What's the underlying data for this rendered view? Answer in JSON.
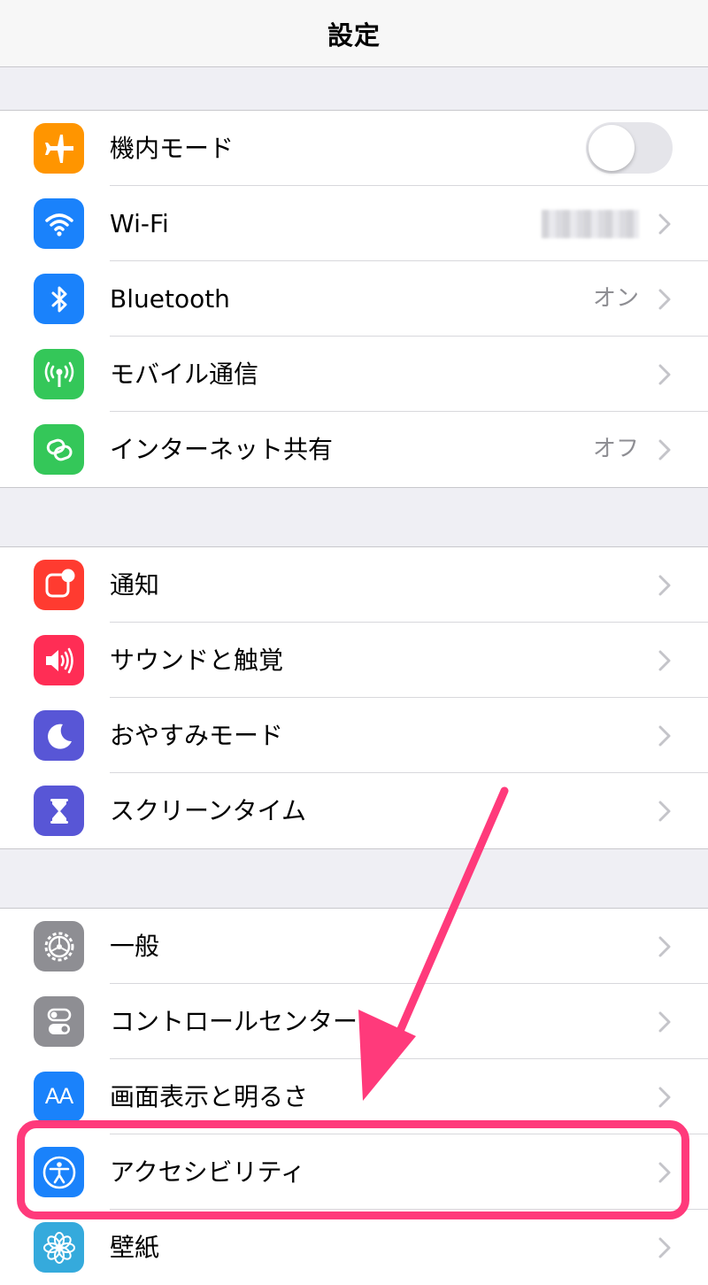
{
  "navbar": {
    "title": "設定"
  },
  "groups": [
    {
      "rows": [
        {
          "icon": "airplane-icon",
          "color": "#ff9500",
          "label": "機内モード",
          "accessory": "toggle",
          "toggle_on": false
        },
        {
          "icon": "wifi-icon",
          "color": "#1a82fb",
          "label": "Wi-Fi",
          "detail": "",
          "accessory": "chevron"
        },
        {
          "icon": "bluetooth-icon",
          "color": "#1a82fb",
          "label": "Bluetooth",
          "detail": "オン",
          "accessory": "chevron"
        },
        {
          "icon": "cellular-icon",
          "color": "#34c759",
          "label": "モバイル通信",
          "accessory": "chevron"
        },
        {
          "icon": "hotspot-icon",
          "color": "#34c759",
          "label": "インターネット共有",
          "detail": "オフ",
          "accessory": "chevron"
        }
      ]
    },
    {
      "rows": [
        {
          "icon": "notifications-icon",
          "color": "#ff3b30",
          "label": "通知",
          "accessory": "chevron"
        },
        {
          "icon": "sound-icon",
          "color": "#ff2d55",
          "label": "サウンドと触覚",
          "accessory": "chevron"
        },
        {
          "icon": "moon-icon",
          "color": "#5856d6",
          "label": "おやすみモード",
          "accessory": "chevron"
        },
        {
          "icon": "hourglass-icon",
          "color": "#5856d6",
          "label": "スクリーンタイム",
          "accessory": "chevron"
        }
      ]
    },
    {
      "rows": [
        {
          "icon": "gear-icon",
          "color": "#8e8e93",
          "label": "一般",
          "accessory": "chevron"
        },
        {
          "icon": "toggles-icon",
          "color": "#8e8e93",
          "label": "コントロールセンター",
          "accessory": "chevron"
        },
        {
          "icon": "text-size-icon",
          "color": "#1a82fb",
          "label": "画面表示と明るさ",
          "icon_text": "AA",
          "accessory": "chevron"
        },
        {
          "icon": "accessibility-icon",
          "color": "#1a82fb",
          "label": "アクセシビリティ",
          "accessory": "chevron"
        },
        {
          "icon": "flower-icon",
          "color": "#35aadc",
          "label": "壁紙",
          "accessory": "chevron"
        }
      ]
    }
  ],
  "annotation": {
    "color": "#ff3a7b"
  }
}
